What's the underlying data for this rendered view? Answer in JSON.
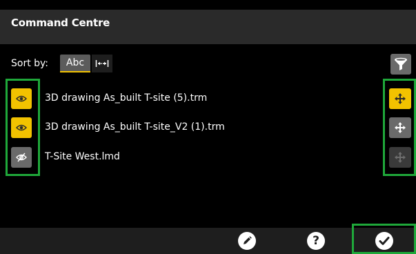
{
  "header": {
    "title": "Command Centre"
  },
  "sort": {
    "label": "Sort by:",
    "options": [
      {
        "label": "Abc",
        "selected": true
      },
      {
        "icon": "distance-sort-icon",
        "selected": false
      }
    ]
  },
  "filter": {
    "icon": "funnel-icon"
  },
  "files": [
    {
      "name": "3D drawing As_built T-site (5).trm",
      "visible": true,
      "move_state": "active"
    },
    {
      "name": "3D drawing As_built T-site_V2 (1).trm",
      "visible": true,
      "move_state": "enabled"
    },
    {
      "name": "T-Site West.lmd",
      "visible": false,
      "move_state": "disabled"
    }
  ],
  "footer": {
    "buttons": [
      {
        "icon": "pencil-icon"
      },
      {
        "label": "?"
      },
      {
        "icon": "checkmark-icon"
      }
    ]
  },
  "colors": {
    "background": "#000000",
    "header": "#2a2a2a",
    "accent": "#f2c200",
    "highlight": "#1fa83a",
    "button_grey": "#6a6a6a"
  }
}
